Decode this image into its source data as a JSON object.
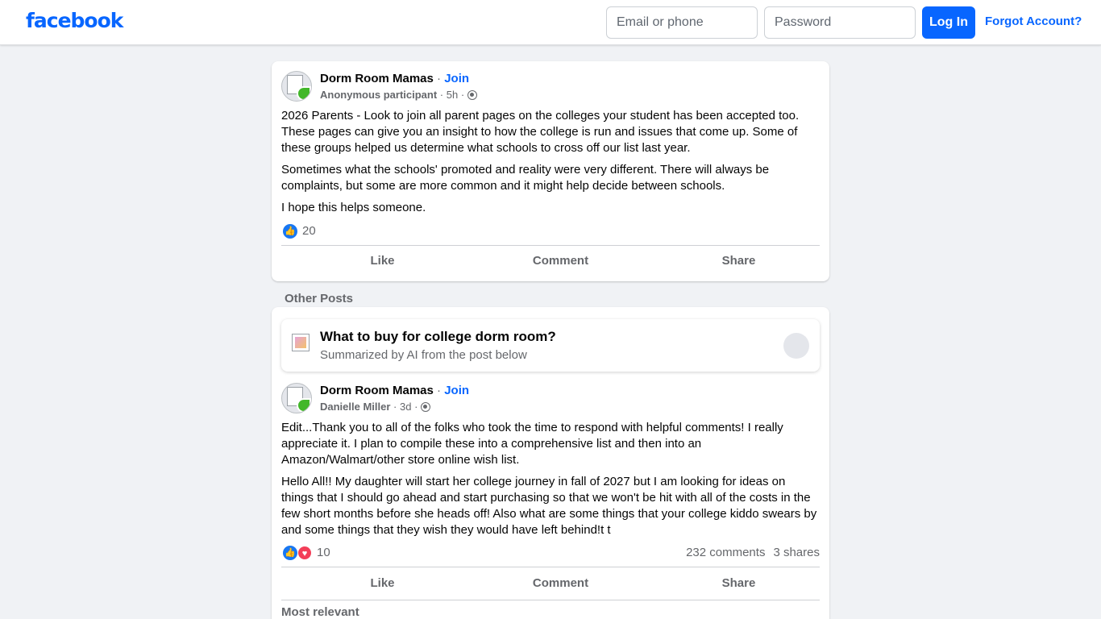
{
  "header": {
    "logo": "facebook",
    "email_placeholder": "Email or phone",
    "password_placeholder": "Password",
    "login_label": "Log In",
    "forgot_label": "Forgot Account?"
  },
  "post1": {
    "group": "Dorm Room Mamas",
    "join": "Join",
    "author": "Anonymous participant",
    "time": "5h",
    "paragraphs": [
      "2026 Parents - Look to join all parent pages on the colleges your student has been accepted too. These pages can give you an insight to how the college is run and issues that come up. Some of these groups helped us determine what schools to cross off our list last year.",
      "Sometimes what the schools' promoted and reality were very different. There will always be complaints, but some are more common and it might help decide between schools.",
      "I hope this helps someone."
    ],
    "reactions": "20",
    "actions": {
      "like": "Like",
      "comment": "Comment",
      "share": "Share"
    }
  },
  "other_posts_label": "Other Posts",
  "ai_summary": {
    "title": "What to buy for college dorm room?",
    "subtitle": "Summarized by AI from the post below"
  },
  "post2": {
    "group": "Dorm Room Mamas",
    "join": "Join",
    "author": "Danielle Miller",
    "time": "3d",
    "paragraphs": [
      "Edit...Thank you to all of the folks who took the time to respond with helpful comments! I really appreciate it. I plan to compile these into a comprehensive list and then into an Amazon/Walmart/other store online wish list.",
      "Hello All!! My daughter will start her college journey in fall of 2027 but I am looking for ideas on things that I should go ahead and start purchasing so that we won't be hit with all of the costs in the few short months before she heads off! Also what are some things that your college kiddo swears by and some things that they wish they would have left behind!t t"
    ],
    "reactions": "10",
    "comments": "232 comments",
    "shares": "3 shares",
    "actions": {
      "like": "Like",
      "comment": "Comment",
      "share": "Share"
    },
    "sort_label": "Most relevant"
  },
  "icons": [
    "globe-icon",
    "like-reaction-icon",
    "love-reaction-icon",
    "group-avatar"
  ],
  "colors": {
    "brand": "#0866ff",
    "background": "#f0f2f5",
    "muted": "#65676b"
  }
}
